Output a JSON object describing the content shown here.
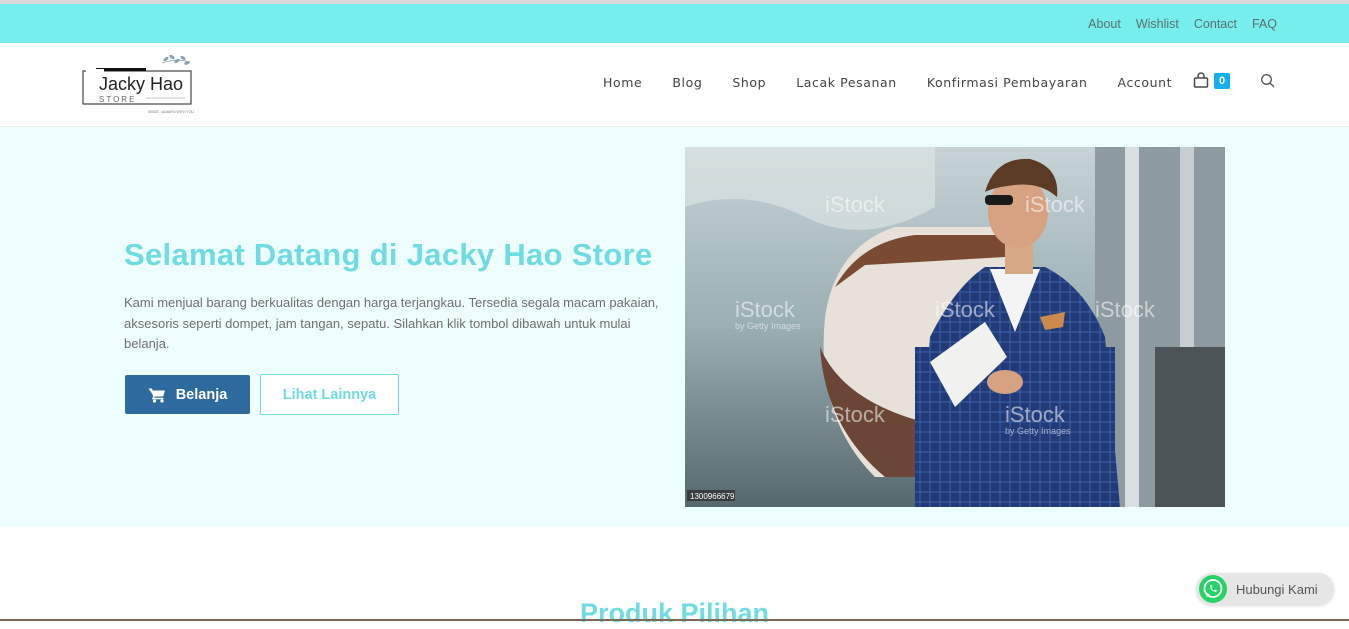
{
  "topbar": {
    "links": [
      "About",
      "Wishlist",
      "Contact",
      "FAQ"
    ]
  },
  "header": {
    "logo": {
      "name": "Jacky Hao",
      "sub": "STORE",
      "tagline": "SINCE · ALWAYS WITH YOU"
    },
    "nav": [
      "Home",
      "Blog",
      "Shop",
      "Lacak Pesanan",
      "Konfirmasi Pembayaran",
      "Account"
    ],
    "cart_count": "0",
    "icons": {
      "cart": "shopping-bag-icon",
      "search": "search-icon"
    }
  },
  "hero": {
    "title": "Selamat Datang di Jacky Hao Store",
    "text": "Kami menjual barang berkualitas dengan harga terjangkau. Tersedia segala macam pakaian, aksesoris seperti dompet, jam tangan, sepatu. Silahkan klik tombol dibawah untuk mulai belanja.",
    "primary_button": "Belanja",
    "secondary_button": "Lihat Lainnya",
    "photo": {
      "watermark": "iStock",
      "watermark_sub": "by Getty Images",
      "stock_id": "1300966679"
    }
  },
  "section": {
    "title": "Produk Pilihan"
  },
  "whatsapp": {
    "label": "Hubungi Kami"
  },
  "colors": {
    "topbar": "#75eeed",
    "accent": "#6fdbe3",
    "primary_button": "#2f6a9f",
    "hero_bg": "#eefdfd",
    "cart_badge": "#13aff0",
    "whatsapp": "#25d366"
  }
}
